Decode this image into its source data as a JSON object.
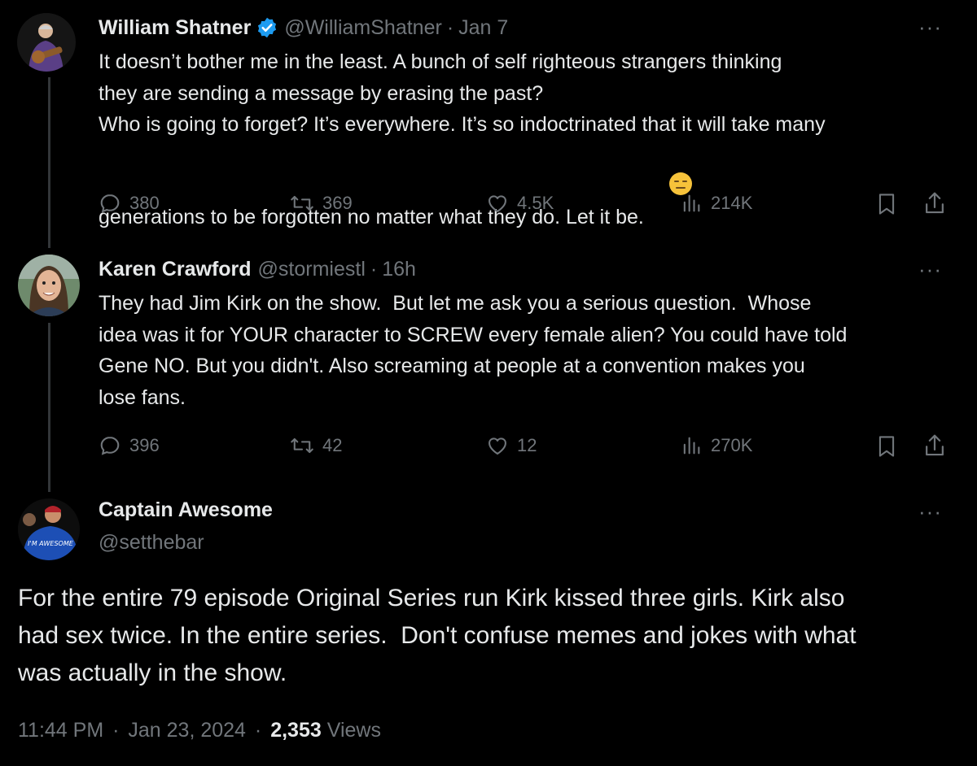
{
  "tweet1": {
    "name": "William Shatner",
    "handle": "@WilliamShatner",
    "sep": "·",
    "date": "Jan 7",
    "text": "It doesn’t bother me in the least. A bunch of self righteous strangers thinking\nthey are sending a message by erasing the past?\nWho is going to forget? It’s everywhere. It’s so indoctrinated that it will take many\ngenerations to be forgotten no matter what they do. Let it be.",
    "emoji": "expressionless-face-emoji",
    "replies": "380",
    "reposts": "369",
    "likes": "4.5K",
    "views": "214K"
  },
  "tweet2": {
    "name": "Karen Crawford",
    "handle": "@stormiestl",
    "sep": "·",
    "date": "16h",
    "text": "They had Jim Kirk on the show.  But let me ask you a serious question.  Whose\nidea was it for YOUR character to SCREW every female alien? You could have told\nGene NO. But you didn't. Also screaming at people at a convention makes you\nlose fans.",
    "replies": "396",
    "reposts": "42",
    "likes": "12",
    "views": "270K"
  },
  "tweet3": {
    "name": "Captain Awesome",
    "handle": "@setthebar",
    "avatar_shirt_text": "I'M AWESOME",
    "text": "For the entire 79 episode Original Series run Kirk kissed three girls. Kirk also\nhad sex twice. In the entire series.  Don't confuse memes and jokes with what\nwas actually in the show.",
    "time": "11:44 PM",
    "sep": "·",
    "date": "Jan 23, 2024",
    "sep2": "·",
    "views_count": "2,353",
    "views_label": "Views"
  },
  "more_glyph": "···",
  "colors": {
    "verified": "#1d9bf0",
    "muted": "#71767b",
    "text": "#e7e9ea",
    "bg": "#000000"
  }
}
